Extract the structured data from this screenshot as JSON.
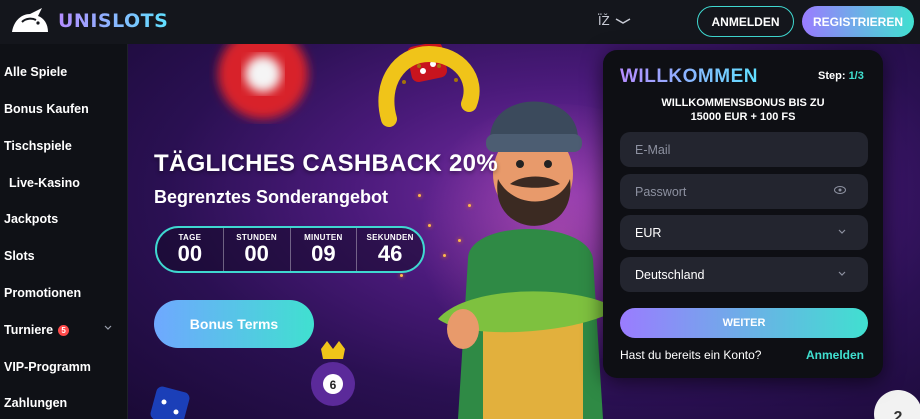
{
  "header": {
    "logo_text": "UNISLOTS",
    "language": "ÏŽ",
    "login_label": "ANMELDEN",
    "register_label": "REGISTRIEREN"
  },
  "sidebar": {
    "items": [
      {
        "label": "Alle Spiele"
      },
      {
        "label": "Bonus Kaufen"
      },
      {
        "label": "Tischspiele"
      },
      {
        "label": "Live-Kasino"
      },
      {
        "label": "Jackpots"
      },
      {
        "label": "Slots"
      },
      {
        "label": "Promotionen"
      },
      {
        "label": "Turniere",
        "badge": "5"
      },
      {
        "label": "VIP-Programm"
      },
      {
        "label": "Zahlungen"
      }
    ]
  },
  "hero": {
    "title": "TÄGLICHES CASHBACK 20%",
    "subtitle": "Begrenztes Sonderangebot",
    "countdown": [
      {
        "label": "TAGE",
        "value": "00"
      },
      {
        "label": "STUNDEN",
        "value": "00"
      },
      {
        "label": "MINUTEN",
        "value": "09"
      },
      {
        "label": "SEKUNDEN",
        "value": "46"
      }
    ],
    "button_label": "Bonus Terms"
  },
  "signup": {
    "title": "WILLKOMMEN",
    "step_label": "Step:",
    "step_value": "1/3",
    "bonus_line1": "WILLKOMMENSBONUS BIS ZU",
    "bonus_line2": "15000 EUR + 100 FS",
    "email_placeholder": "E-Mail",
    "password_placeholder": "Passwort",
    "currency_value": "EUR",
    "country_value": "Deutschland",
    "continue_label": "WEITER",
    "have_account_text": "Hast du bereits ein Konto?",
    "login_link": "Anmelden"
  },
  "colors": {
    "accent_teal": "#40e0d0",
    "accent_purple": "#9a7cff",
    "badge_red": "#ff4b4b"
  }
}
